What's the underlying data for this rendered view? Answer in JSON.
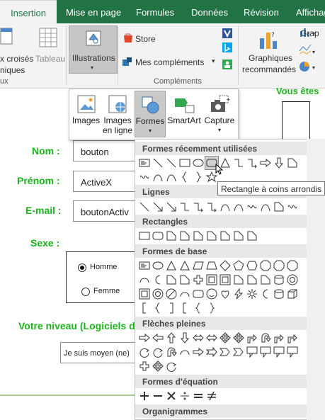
{
  "ribbon_tabs": [
    "Insertion",
    "Mise en page",
    "Formules",
    "Données",
    "Révision",
    "Affichage"
  ],
  "ribbon": {
    "pivot_partial": "x croisés",
    "pivot_partial2": "niques",
    "table_label": "Tableau",
    "illustrations_label": "Illustrations",
    "store_label": "Store",
    "addins_label": "Mes compléments",
    "complements_group": "Compléments",
    "charts_label": "Graphiques",
    "charts_label2": "recommandés",
    "graph_partial": "Grap",
    "left_group_partial": "ux"
  },
  "illustrations_menu": {
    "images": "Images",
    "images_online": "Images en ligne",
    "shapes": "Formes",
    "smartart": "SmartArt",
    "capture": "Capture"
  },
  "form": {
    "nom_label": "Nom :",
    "nom_value": "bouton",
    "prenom_label": "Prénom :",
    "prenom_value": "ActiveX",
    "email_label": "E-mail :",
    "email_value": "boutonActiv",
    "sexe_label": "Sexe :",
    "homme": "Homme",
    "femme": "Femme",
    "niveau_label": "Votre niveau (Logiciels d",
    "niveau_value": "Je suis moyen (ne)",
    "vous_etes": "Vous êtes"
  },
  "shapes_gallery": {
    "categories": [
      "Formes récemment utilisées",
      "Lignes",
      "Rectangles",
      "Formes de base",
      "Flèches pleines",
      "Formes d'équation",
      "Organigrammes"
    ]
  },
  "tooltip": "Rectangle à coins arrondis",
  "colors": {
    "tab_bar": "#217346",
    "label_green": "#1db31d",
    "orange": "#f4b183"
  }
}
